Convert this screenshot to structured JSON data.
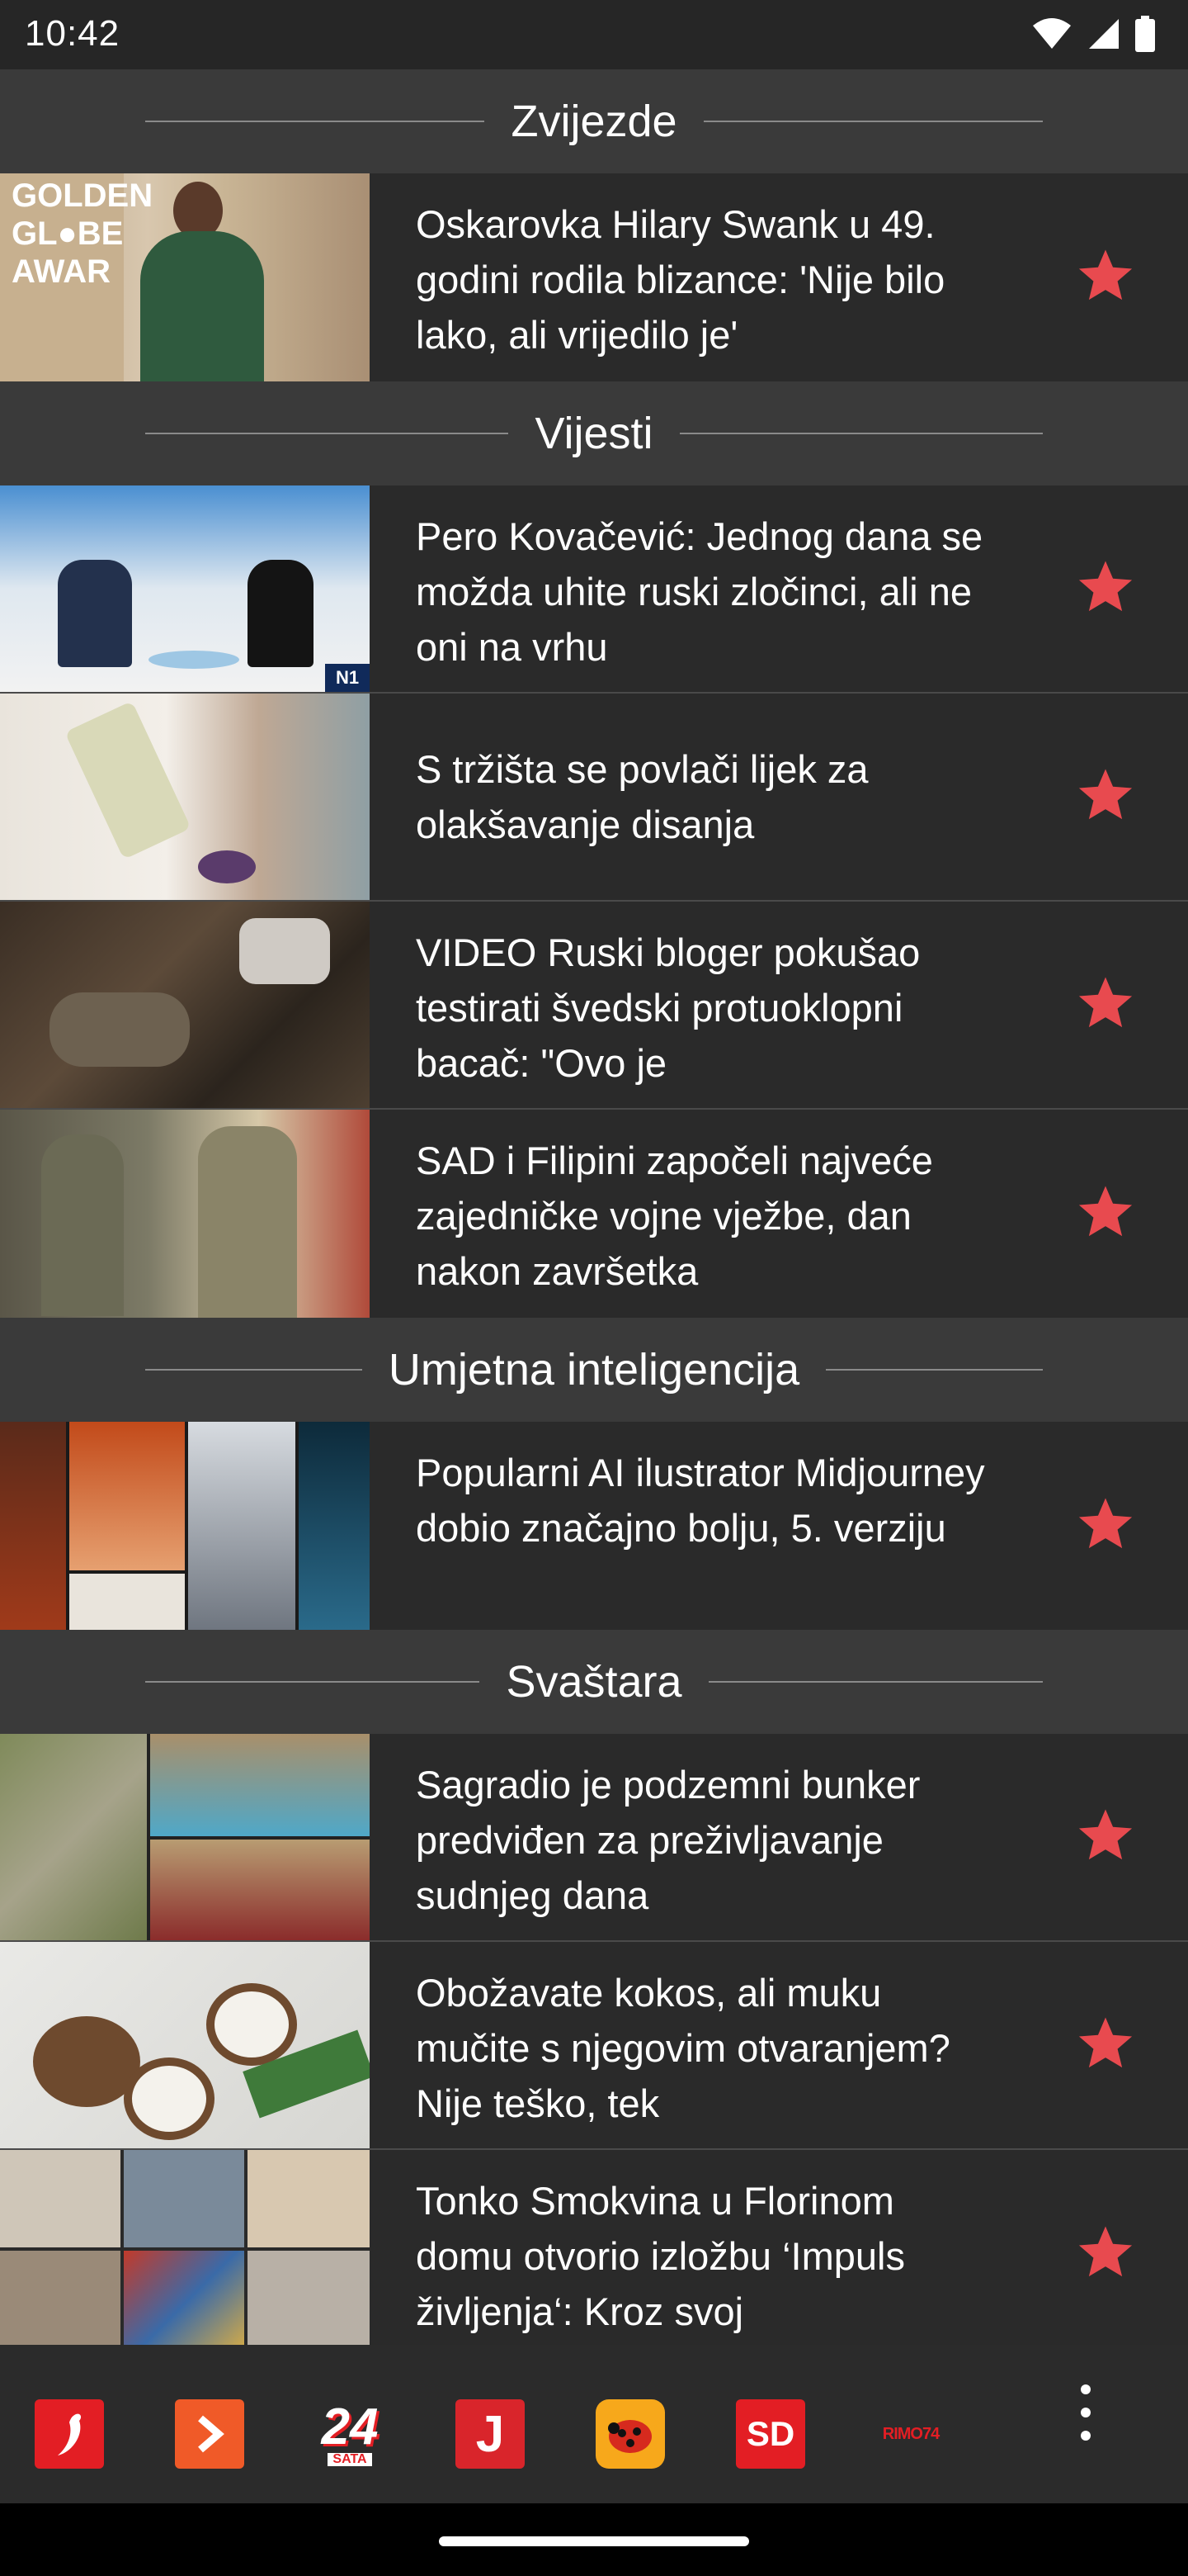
{
  "status": {
    "time": "10:42",
    "wifi_icon": "wifi-icon",
    "signal_icon": "signal-icon",
    "battery_icon": "battery-icon"
  },
  "colors": {
    "accent_star": "#e84a4f",
    "section_bg": "#3a3a3a",
    "card_bg": "#2a2a2a"
  },
  "sections": [
    {
      "title": "Zvijezde",
      "articles": [
        {
          "headline": "Oskarovka Hilary Swank u 49. godini rodila blizance: 'Nije bilo lako, ali vrijedilo je'"
        }
      ]
    },
    {
      "title": "Vijesti",
      "articles": [
        {
          "headline": "Pero Kovačević: Jednog dana se možda uhite ruski zločinci, ali ne oni na vrhu"
        },
        {
          "headline": "S tržišta se povlači lijek za olakšavanje disanja"
        },
        {
          "headline": "VIDEO Ruski bloger pokušao testirati švedski protuoklopni bacač: \"Ovo je"
        },
        {
          "headline": "SAD i Filipini započeli najveće zajedničke vojne vježbe, dan nakon završetka"
        }
      ]
    },
    {
      "title": "Umjetna inteligencija",
      "articles": [
        {
          "headline": "Popularni AI ilustrator Midjourney dobio značajno bolju, 5. verziju"
        }
      ]
    },
    {
      "title": "Svaštara",
      "articles": [
        {
          "headline": "Sagradio je podzemni bunker predviđen za preživljavanje sudnjeg dana"
        },
        {
          "headline": "Obožavate kokos, ali muku mučite s njegovim otvaranjem? Nije teško, tek"
        },
        {
          "headline": "Tonko Smokvina u Florinom domu otvorio izložbu ‘Impuls življenja‘: Kroz svoj"
        }
      ]
    }
  ],
  "bottom_bar": {
    "sites": [
      {
        "name": "chili-icon",
        "label": "",
        "color": "#e31e24"
      },
      {
        "name": "arrow-icon",
        "label": "",
        "color": "#f05a28"
      },
      {
        "name": "24sata-icon",
        "label": "24",
        "sub": "SATA",
        "color": "#e31e24"
      },
      {
        "name": "jutarnji-icon",
        "label": "J",
        "color": "#d9252b"
      },
      {
        "name": "ladybug-icon",
        "label": "",
        "color": "#f7a81b"
      },
      {
        "name": "slobodna-dalmacija-icon",
        "label": "SD",
        "color": "#e31e24"
      },
      {
        "name": "rimo74-icon",
        "label": "RIMO74",
        "color": "#e31e24"
      }
    ],
    "menu_icon": "more-vertical-icon"
  }
}
